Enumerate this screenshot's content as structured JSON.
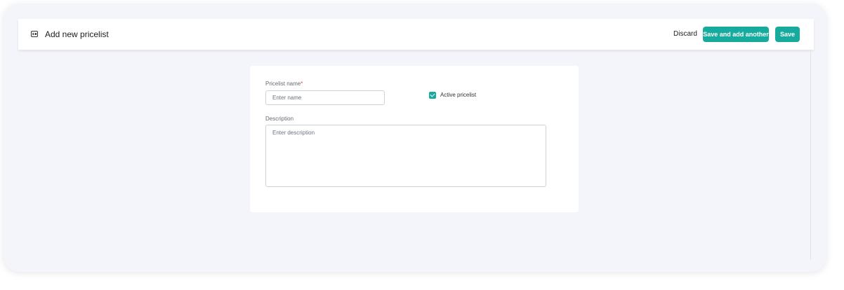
{
  "header": {
    "title": "Add new pricelist",
    "icon": "pricelist-icon",
    "discard_label": "Discard",
    "save_another_label": "Save and add another",
    "save_label": "Save"
  },
  "form": {
    "name_label": "Pricelist name",
    "name_required_mark": "*",
    "name_placeholder": "Enter name",
    "name_value": "",
    "active_label": "Active pricelist",
    "active_checked": true,
    "description_label": "Description",
    "description_placeholder": "Enter description",
    "description_value": ""
  },
  "colors": {
    "accent": "#17ab9e",
    "background": "#f4f5fa"
  }
}
